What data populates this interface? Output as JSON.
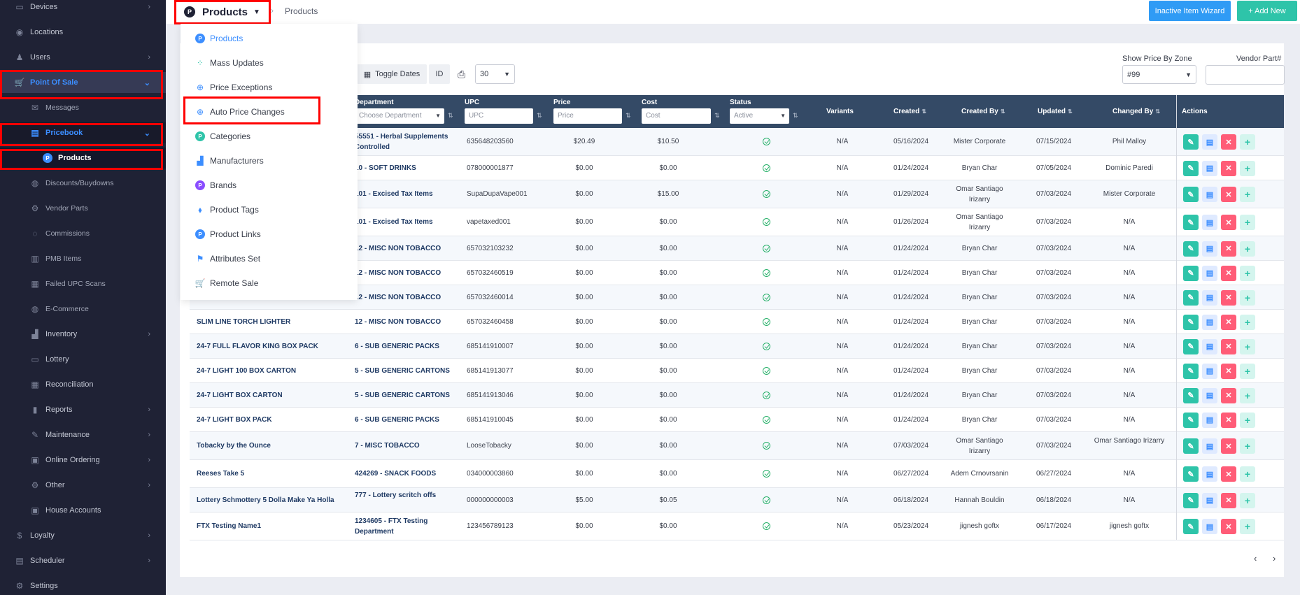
{
  "sidebar": {
    "items": [
      {
        "label": "Devices",
        "icon": "devices-icon",
        "chev": "›"
      },
      {
        "label": "Locations",
        "icon": "location-pin-icon",
        "chev": ""
      },
      {
        "label": "Users",
        "icon": "users-icon",
        "chev": "›"
      },
      {
        "label": "Point Of Sale",
        "icon": "cart-icon",
        "chev": "⌄"
      },
      {
        "label": "Messages",
        "icon": "messages-icon",
        "chev": ""
      },
      {
        "label": "Pricebook",
        "icon": "pricebook-icon",
        "chev": "⌄"
      },
      {
        "label": "Products",
        "icon": "products-p-icon",
        "chev": ""
      },
      {
        "label": "Discounts/Buydowns",
        "icon": "discount-icon",
        "chev": ""
      },
      {
        "label": "Vendor Parts",
        "icon": "vendor-parts-icon",
        "chev": ""
      },
      {
        "label": "Commissions",
        "icon": "commissions-icon",
        "chev": ""
      },
      {
        "label": "PMB Items",
        "icon": "pmb-icon",
        "chev": ""
      },
      {
        "label": "Failed UPC Scans",
        "icon": "failed-scan-icon",
        "chev": ""
      },
      {
        "label": "E-Commerce",
        "icon": "ecommerce-icon",
        "chev": ""
      },
      {
        "label": "Inventory",
        "icon": "inventory-icon",
        "chev": "›"
      },
      {
        "label": "Lottery",
        "icon": "lottery-icon",
        "chev": ""
      },
      {
        "label": "Reconciliation",
        "icon": "reconciliation-icon",
        "chev": ""
      },
      {
        "label": "Reports",
        "icon": "reports-icon",
        "chev": "›"
      },
      {
        "label": "Maintenance",
        "icon": "wrench-icon",
        "chev": "›"
      },
      {
        "label": "Online Ordering",
        "icon": "bag-icon",
        "chev": "›"
      },
      {
        "label": "Other",
        "icon": "gears-icon",
        "chev": "›"
      },
      {
        "label": "House Accounts",
        "icon": "house-accounts-icon",
        "chev": ""
      },
      {
        "label": "Loyalty",
        "icon": "dollar-icon",
        "chev": "›"
      },
      {
        "label": "Scheduler",
        "icon": "calendar-icon",
        "chev": "›"
      },
      {
        "label": "Settings",
        "icon": "settings-gear-icon",
        "chev": ""
      }
    ]
  },
  "topbar": {
    "crumb_label": "Products",
    "crumb_logo": "P",
    "crumb_current": "Products",
    "inactive_btn": "Inactive Item Wizard",
    "add_btn": "+ Add New"
  },
  "toolbar": {
    "toggle_dates": "Toggle Dates",
    "id": "ID",
    "page_size": "30",
    "zone_label": "Show Price By Zone",
    "zone_value": "#99",
    "vendor_label": "Vendor Part#"
  },
  "menu": {
    "items": [
      {
        "label": "Products"
      },
      {
        "label": "Mass Updates"
      },
      {
        "label": "Price Exceptions"
      },
      {
        "label": "Auto Price Changes"
      },
      {
        "label": "Categories"
      },
      {
        "label": "Manufacturers"
      },
      {
        "label": "Brands"
      },
      {
        "label": "Product Tags"
      },
      {
        "label": "Product Links"
      },
      {
        "label": "Attributes Set"
      },
      {
        "label": "Remote Sale"
      }
    ]
  },
  "table": {
    "headers": {
      "department": "Department",
      "department_placeholder": "Choose Department",
      "upc": "UPC",
      "upc_placeholder": "UPC",
      "price": "Price",
      "price_placeholder": "Price",
      "cost": "Cost",
      "cost_placeholder": "Cost",
      "status": "Status",
      "status_value": "Active",
      "variants": "Variants",
      "created": "Created",
      "created_by": "Created By",
      "updated": "Updated",
      "changed_by": "Changed By",
      "actions": "Actions"
    },
    "rows": [
      {
        "name": "",
        "dept": "55551 - Herbal Supplements Controlled",
        "upc": "635648203560",
        "price": "$20.49",
        "cost": "$10.50",
        "variants": "N/A",
        "created": "05/16/2024",
        "created_by": "Mister Corporate",
        "updated": "07/15/2024",
        "changed_by": "Phil Malloy"
      },
      {
        "name": "",
        "dept": "10 - SOFT DRINKS",
        "upc": "078000001877",
        "price": "$0.00",
        "cost": "$0.00",
        "variants": "N/A",
        "created": "01/24/2024",
        "created_by": "Bryan Char",
        "updated": "07/05/2024",
        "changed_by": "Dominic Paredi"
      },
      {
        "name": "",
        "dept": "101 - Excised Tax Items",
        "upc": "SupaDupaVape001",
        "price": "$0.00",
        "cost": "$15.00",
        "variants": "N/A",
        "created": "01/29/2024",
        "created_by": "Omar Santiago Irizarry",
        "updated": "07/03/2024",
        "changed_by": "Mister Corporate"
      },
      {
        "name": "",
        "dept": "101 - Excised Tax Items",
        "upc": "vapetaxed001",
        "price": "$0.00",
        "cost": "$0.00",
        "variants": "N/A",
        "created": "01/26/2024",
        "created_by": "Omar Santiago Irizarry",
        "updated": "07/03/2024",
        "changed_by": "N/A"
      },
      {
        "name": "",
        "dept": "12 - MISC NON TOBACCO",
        "upc": "657032103232",
        "price": "$0.00",
        "cost": "$0.00",
        "variants": "N/A",
        "created": "01/24/2024",
        "created_by": "Bryan Char",
        "updated": "07/03/2024",
        "changed_by": "N/A"
      },
      {
        "name": "",
        "dept": "12 - MISC NON TOBACCO",
        "upc": "657032460519",
        "price": "$0.00",
        "cost": "$0.00",
        "variants": "N/A",
        "created": "01/24/2024",
        "created_by": "Bryan Char",
        "updated": "07/03/2024",
        "changed_by": "N/A"
      },
      {
        "name": "",
        "dept": "12 - MISC NON TOBACCO",
        "upc": "657032460014",
        "price": "$0.00",
        "cost": "$0.00",
        "variants": "N/A",
        "created": "01/24/2024",
        "created_by": "Bryan Char",
        "updated": "07/03/2024",
        "changed_by": "N/A"
      },
      {
        "name": "SLIM LINE TORCH LIGHTER",
        "dept": "12 - MISC NON TOBACCO",
        "upc": "657032460458",
        "price": "$0.00",
        "cost": "$0.00",
        "variants": "N/A",
        "created": "01/24/2024",
        "created_by": "Bryan Char",
        "updated": "07/03/2024",
        "changed_by": "N/A"
      },
      {
        "name": "24-7 FULL FLAVOR KING BOX PACK",
        "dept": "6 - SUB GENERIC PACKS",
        "upc": "685141910007",
        "price": "$0.00",
        "cost": "$0.00",
        "variants": "N/A",
        "created": "01/24/2024",
        "created_by": "Bryan Char",
        "updated": "07/03/2024",
        "changed_by": "N/A"
      },
      {
        "name": "24-7 LIGHT 100 BOX CARTON",
        "dept": "5 - SUB GENERIC CARTONS",
        "upc": "685141913077",
        "price": "$0.00",
        "cost": "$0.00",
        "variants": "N/A",
        "created": "01/24/2024",
        "created_by": "Bryan Char",
        "updated": "07/03/2024",
        "changed_by": "N/A"
      },
      {
        "name": "24-7 LIGHT BOX CARTON",
        "dept": "5 - SUB GENERIC CARTONS",
        "upc": "685141913046",
        "price": "$0.00",
        "cost": "$0.00",
        "variants": "N/A",
        "created": "01/24/2024",
        "created_by": "Bryan Char",
        "updated": "07/03/2024",
        "changed_by": "N/A"
      },
      {
        "name": "24-7 LIGHT BOX PACK",
        "dept": "6 - SUB GENERIC PACKS",
        "upc": "685141910045",
        "price": "$0.00",
        "cost": "$0.00",
        "variants": "N/A",
        "created": "01/24/2024",
        "created_by": "Bryan Char",
        "updated": "07/03/2024",
        "changed_by": "N/A"
      },
      {
        "name": "Tobacky by the Ounce",
        "dept": "7 - MISC TOBACCO",
        "upc": "LooseTobacky",
        "price": "$0.00",
        "cost": "$0.00",
        "variants": "N/A",
        "created": "07/03/2024",
        "created_by": "Omar Santiago Irizarry",
        "updated": "07/03/2024",
        "changed_by": "Omar Santiago Irizarry"
      },
      {
        "name": "Reeses Take 5",
        "dept": "424269 - SNACK FOODS",
        "upc": "034000003860",
        "price": "$0.00",
        "cost": "$0.00",
        "variants": "N/A",
        "created": "06/27/2024",
        "created_by": "Adem Crnovrsanin",
        "updated": "06/27/2024",
        "changed_by": "N/A"
      },
      {
        "name": "Lottery Schmottery 5 Dolla Make Ya Holla",
        "dept": "777 - Lottery scritch offs",
        "upc": "000000000003",
        "price": "$5.00",
        "cost": "$0.05",
        "variants": "N/A",
        "created": "06/18/2024",
        "created_by": "Hannah Bouldin",
        "updated": "06/18/2024",
        "changed_by": "N/A"
      },
      {
        "name": "FTX Testing Name1",
        "dept": "1234605 - FTX Testing Department",
        "upc": "123456789123",
        "price": "$0.00",
        "cost": "$0.00",
        "variants": "N/A",
        "created": "05/23/2024",
        "created_by": "jignesh goftx",
        "updated": "06/17/2024",
        "changed_by": "jignesh goftx"
      }
    ]
  },
  "pager": {
    "prev": "‹",
    "next": "›"
  }
}
